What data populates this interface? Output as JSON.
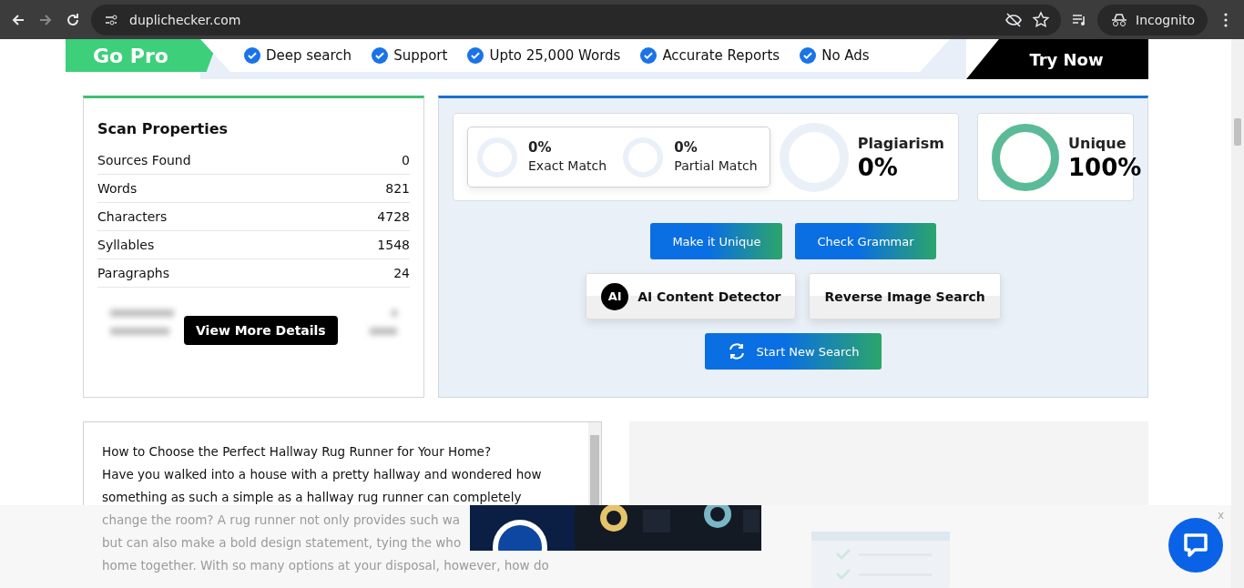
{
  "browser": {
    "url": "duplichecker.com",
    "mode": "Incognito"
  },
  "promo": {
    "badge": "Go Pro",
    "features": [
      "Deep search",
      "Support",
      "Upto 25,000 Words",
      "Accurate Reports",
      "No Ads"
    ],
    "cta": "Try Now"
  },
  "scan_properties": {
    "title": "Scan Properties",
    "rows": [
      {
        "label": "Sources Found",
        "value": "0"
      },
      {
        "label": "Words",
        "value": "821"
      },
      {
        "label": "Characters",
        "value": "4728"
      },
      {
        "label": "Syllables",
        "value": "1548"
      },
      {
        "label": "Paragraphs",
        "value": "24"
      }
    ],
    "details_button": "View More Details"
  },
  "results": {
    "matches": [
      {
        "value": "0%",
        "label": "Exact Match",
        "level": 0
      },
      {
        "value": "0%",
        "label": "Partial Match",
        "level": 0
      }
    ],
    "plagiarism": {
      "label": "Plagiarism",
      "value": "0%",
      "level": 0
    },
    "unique": {
      "label": "Unique",
      "value": "100%",
      "level": 1
    },
    "button_rows": [
      [
        {
          "label": "Make it Unique",
          "kind": "gradient"
        },
        {
          "label": "Check Grammar",
          "kind": "gradient"
        }
      ],
      [
        {
          "label": "AI Content Detector",
          "kind": "light",
          "icon_text": "AI"
        },
        {
          "label": "Reverse Image Search",
          "kind": "light"
        }
      ],
      [
        {
          "label": "Start New Search",
          "kind": "refresh"
        }
      ]
    ]
  },
  "text_input": {
    "lines": [
      {
        "text": "How to Choose the Perfect Hallway Rug Runner for Your Home?",
        "faded": false
      },
      {
        "text": "Have you walked into a house with a pretty hallway and wondered how",
        "faded": false
      },
      {
        "text": "something as such a simple as a hallway rug runner can completely",
        "faded": false
      },
      {
        "text": "change the room? A rug runner not only provides such wa",
        "faded": true
      },
      {
        "text": "but can also make a bold design statement, tying the who",
        "faded": true
      },
      {
        "text": "home together. With so many options at your disposal, however, how do",
        "faded": true
      }
    ]
  },
  "ad_bar": {
    "close": "x"
  }
}
